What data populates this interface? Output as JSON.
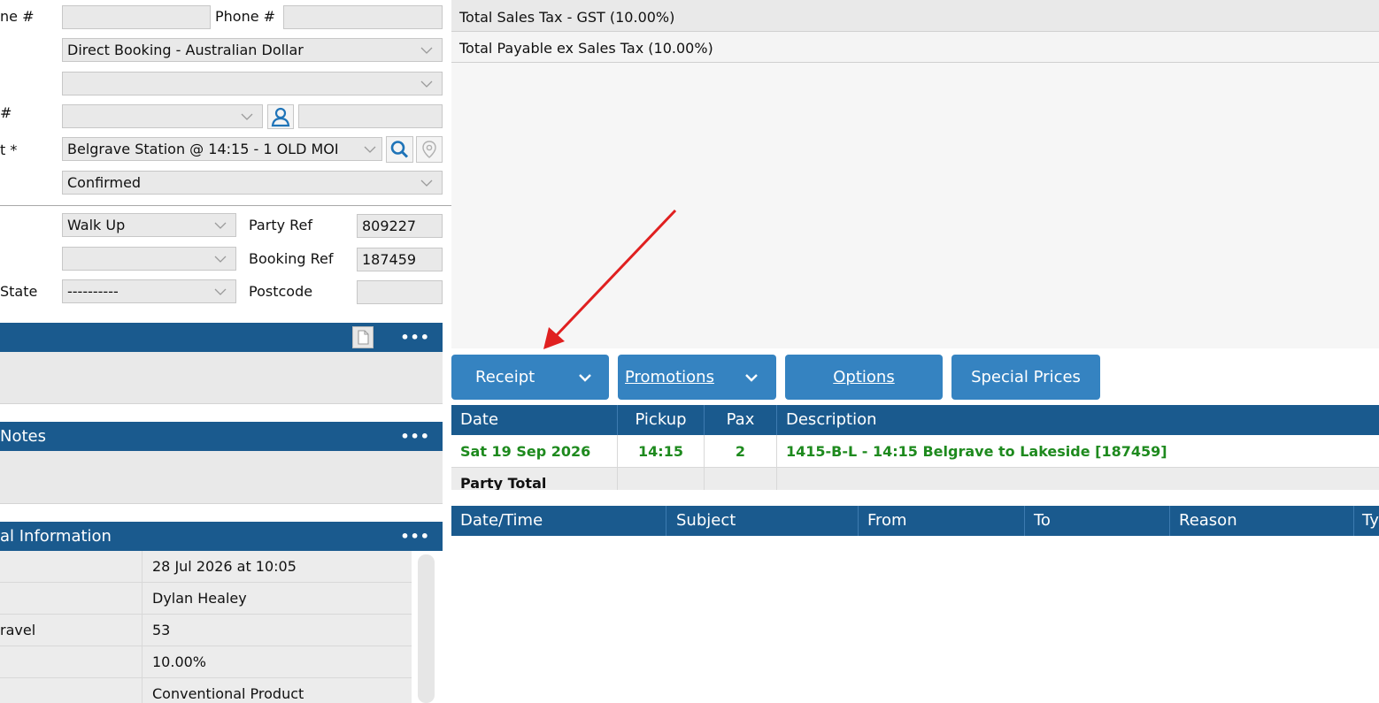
{
  "form": {
    "phone_label_left": "ne #",
    "phone_label": "Phone #",
    "phone_value": "",
    "agent_select": "Direct Booking - Australian Dollar",
    "blank_select": "",
    "hash_label": "#",
    "contact_select": "",
    "contact_text": "",
    "pickup_label": "t *",
    "pickup_select": "Belgrave Station @ 14:15 - 1 OLD MOI",
    "status_select": "Confirmed",
    "source_select": "Walk Up",
    "party_ref_label": "Party Ref",
    "party_ref_value": "809227",
    "booking_ref_label": "Booking Ref",
    "booking_ref_value": "187459",
    "state_label": "State",
    "state_select": "----------",
    "postcode_label": "Postcode",
    "postcode_value": ""
  },
  "sections": {
    "notes_title": "Notes",
    "info_title": "al Information",
    "dots": "•••"
  },
  "info_rows": [
    {
      "key": "",
      "value": "28 Jul 2026 at 10:05"
    },
    {
      "key": "",
      "value": "Dylan Healey"
    },
    {
      "key": "ravel",
      "value": "53"
    },
    {
      "key": "",
      "value": "10.00%"
    },
    {
      "key": "",
      "value": "Conventional Product"
    }
  ],
  "totals": {
    "gst": "Total Sales Tax - GST (10.00%)",
    "ex_tax": "Total Payable ex Sales Tax (10.00%)"
  },
  "buttons": {
    "receipt": "Receipt",
    "promotions": "Promotions",
    "options": "Options",
    "special_prices": "Special Prices"
  },
  "booking_grid": {
    "headers": [
      "Date",
      "Pickup",
      "Pax",
      "Description"
    ],
    "row": [
      "Sat 19 Sep 2026",
      "14:15",
      "2",
      "1415-B-L - 14:15 Belgrave to Lakeside [187459]"
    ],
    "total_label": "Party Total"
  },
  "history_grid": {
    "headers": [
      "Date/Time",
      "Subject",
      "From",
      "To",
      "Reason",
      "Ty"
    ]
  },
  "colors": {
    "header_blue": "#1a5a8e",
    "button_blue": "#3583c1",
    "row_green": "#1e8a1e",
    "arrow_red": "#e02020"
  },
  "icons": {
    "user": "user-icon",
    "search": "search-icon",
    "location": "location-pin-icon",
    "document": "document-icon"
  }
}
